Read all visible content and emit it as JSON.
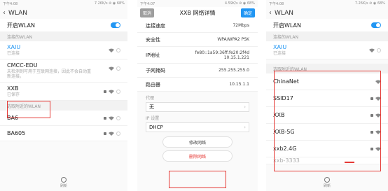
{
  "phone1": {
    "status_time": "下午4:08",
    "status_right": "7.26K/s ⊘ ◉ 68%",
    "title": "WLAN",
    "toggle_label": "开启WLAN",
    "connected_section": "连接的WLAN",
    "connected": [
      {
        "name": "XAIU",
        "sub": "已连接",
        "blue": true
      },
      {
        "name": "CMCC-EDU",
        "sub": "未检测到可用于互联网连接，因此不会自动重新连接。",
        "blue": false
      },
      {
        "name": "XXB",
        "sub": "已保存",
        "blue": false
      }
    ],
    "nearby_section": "选取附近的WLAN",
    "nearby": [
      "BA6",
      "BA605"
    ],
    "refresh_label": "刷新"
  },
  "phone2": {
    "status_time": "下午4:07",
    "status_right": "4.59K/s ⊘ ◉ 68%",
    "cancel_label": "取消",
    "title": "XXB 网络详情",
    "ok_label": "确定",
    "details": [
      {
        "k": "连接速度",
        "v": "72Mbps"
      },
      {
        "k": "安全性",
        "v": "WPA/WPA2 PSK"
      },
      {
        "k": "IP地址",
        "v": "fe80::1a59:36ff:fe20:2f4d\n10.15.1.221"
      },
      {
        "k": "子网掩码",
        "v": "255.255.255.0"
      },
      {
        "k": "路由器",
        "v": "10.15.1.1"
      }
    ],
    "proxy_label": "代理",
    "proxy_value": "无",
    "ip_settings_label": "IP 设置",
    "ip_settings_value": "DHCP",
    "modify_label": "修改网络",
    "delete_label": "删除网络"
  },
  "phone3": {
    "status_time": "下午4:08",
    "status_right": "7.26K/s ⊘ ◉ 68%",
    "title": "WLAN",
    "toggle_label": "开启WLAN",
    "connected_section": "连接的WLAN",
    "connected_name": "XAIU",
    "connected_sub": "已连接",
    "nearby_section": "选取附近的WLAN",
    "nearby": [
      "ChinaNet",
      "SSID17",
      "XXB",
      "XXB-5G",
      "xxb2.4G"
    ],
    "partial_item": "xxb-3333",
    "refresh_label": "刷新"
  },
  "colors": {
    "accent": "#2196f3",
    "highlight": "#e53935"
  }
}
